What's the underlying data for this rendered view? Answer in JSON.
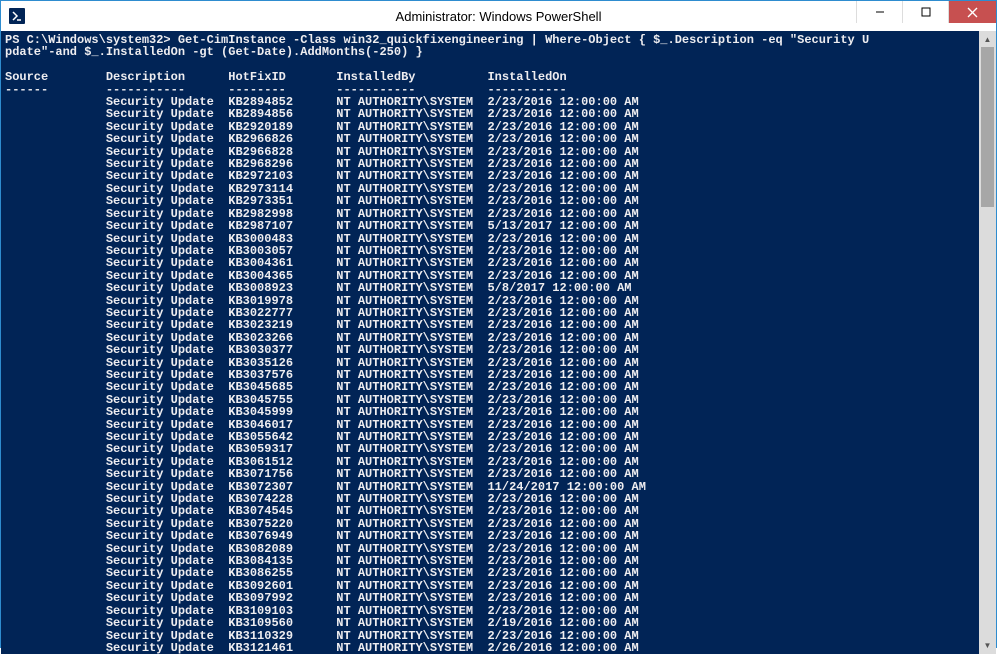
{
  "window": {
    "title": "Administrator: Windows PowerShell"
  },
  "console": {
    "prompt": "PS C:\\Windows\\system32>",
    "command_line1": "PS C:\\Windows\\system32> Get-CimInstance -Class win32_quickfixengineering | Where-Object { $_.Description -eq \"Security U",
    "command_line2": "pdate\"-and $_.InstalledOn -gt (Get-Date).AddMonths(-250) }",
    "headers": {
      "source": "Source",
      "description": "Description",
      "hotfixid": "HotFixID",
      "installedby": "InstalledBy",
      "installedon": "InstalledOn"
    },
    "rows": [
      {
        "source": "",
        "description": "Security Update",
        "hotfixid": "KB2894852",
        "installedby": "NT AUTHORITY\\SYSTEM",
        "installedon": "2/23/2016 12:00:00 AM"
      },
      {
        "source": "",
        "description": "Security Update",
        "hotfixid": "KB2894856",
        "installedby": "NT AUTHORITY\\SYSTEM",
        "installedon": "2/23/2016 12:00:00 AM"
      },
      {
        "source": "",
        "description": "Security Update",
        "hotfixid": "KB2920189",
        "installedby": "NT AUTHORITY\\SYSTEM",
        "installedon": "2/23/2016 12:00:00 AM"
      },
      {
        "source": "",
        "description": "Security Update",
        "hotfixid": "KB2966826",
        "installedby": "NT AUTHORITY\\SYSTEM",
        "installedon": "2/23/2016 12:00:00 AM"
      },
      {
        "source": "",
        "description": "Security Update",
        "hotfixid": "KB2966828",
        "installedby": "NT AUTHORITY\\SYSTEM",
        "installedon": "2/23/2016 12:00:00 AM"
      },
      {
        "source": "",
        "description": "Security Update",
        "hotfixid": "KB2968296",
        "installedby": "NT AUTHORITY\\SYSTEM",
        "installedon": "2/23/2016 12:00:00 AM"
      },
      {
        "source": "",
        "description": "Security Update",
        "hotfixid": "KB2972103",
        "installedby": "NT AUTHORITY\\SYSTEM",
        "installedon": "2/23/2016 12:00:00 AM"
      },
      {
        "source": "",
        "description": "Security Update",
        "hotfixid": "KB2973114",
        "installedby": "NT AUTHORITY\\SYSTEM",
        "installedon": "2/23/2016 12:00:00 AM"
      },
      {
        "source": "",
        "description": "Security Update",
        "hotfixid": "KB2973351",
        "installedby": "NT AUTHORITY\\SYSTEM",
        "installedon": "2/23/2016 12:00:00 AM"
      },
      {
        "source": "",
        "description": "Security Update",
        "hotfixid": "KB2982998",
        "installedby": "NT AUTHORITY\\SYSTEM",
        "installedon": "2/23/2016 12:00:00 AM"
      },
      {
        "source": "",
        "description": "Security Update",
        "hotfixid": "KB2987107",
        "installedby": "NT AUTHORITY\\SYSTEM",
        "installedon": "5/13/2017 12:00:00 AM"
      },
      {
        "source": "",
        "description": "Security Update",
        "hotfixid": "KB3000483",
        "installedby": "NT AUTHORITY\\SYSTEM",
        "installedon": "2/23/2016 12:00:00 AM"
      },
      {
        "source": "",
        "description": "Security Update",
        "hotfixid": "KB3003057",
        "installedby": "NT AUTHORITY\\SYSTEM",
        "installedon": "2/23/2016 12:00:00 AM"
      },
      {
        "source": "",
        "description": "Security Update",
        "hotfixid": "KB3004361",
        "installedby": "NT AUTHORITY\\SYSTEM",
        "installedon": "2/23/2016 12:00:00 AM"
      },
      {
        "source": "",
        "description": "Security Update",
        "hotfixid": "KB3004365",
        "installedby": "NT AUTHORITY\\SYSTEM",
        "installedon": "2/23/2016 12:00:00 AM"
      },
      {
        "source": "",
        "description": "Security Update",
        "hotfixid": "KB3008923",
        "installedby": "NT AUTHORITY\\SYSTEM",
        "installedon": "5/8/2017 12:00:00 AM"
      },
      {
        "source": "",
        "description": "Security Update",
        "hotfixid": "KB3019978",
        "installedby": "NT AUTHORITY\\SYSTEM",
        "installedon": "2/23/2016 12:00:00 AM"
      },
      {
        "source": "",
        "description": "Security Update",
        "hotfixid": "KB3022777",
        "installedby": "NT AUTHORITY\\SYSTEM",
        "installedon": "2/23/2016 12:00:00 AM"
      },
      {
        "source": "",
        "description": "Security Update",
        "hotfixid": "KB3023219",
        "installedby": "NT AUTHORITY\\SYSTEM",
        "installedon": "2/23/2016 12:00:00 AM"
      },
      {
        "source": "",
        "description": "Security Update",
        "hotfixid": "KB3023266",
        "installedby": "NT AUTHORITY\\SYSTEM",
        "installedon": "2/23/2016 12:00:00 AM"
      },
      {
        "source": "",
        "description": "Security Update",
        "hotfixid": "KB3030377",
        "installedby": "NT AUTHORITY\\SYSTEM",
        "installedon": "2/23/2016 12:00:00 AM"
      },
      {
        "source": "",
        "description": "Security Update",
        "hotfixid": "KB3035126",
        "installedby": "NT AUTHORITY\\SYSTEM",
        "installedon": "2/23/2016 12:00:00 AM"
      },
      {
        "source": "",
        "description": "Security Update",
        "hotfixid": "KB3037576",
        "installedby": "NT AUTHORITY\\SYSTEM",
        "installedon": "2/23/2016 12:00:00 AM"
      },
      {
        "source": "",
        "description": "Security Update",
        "hotfixid": "KB3045685",
        "installedby": "NT AUTHORITY\\SYSTEM",
        "installedon": "2/23/2016 12:00:00 AM"
      },
      {
        "source": "",
        "description": "Security Update",
        "hotfixid": "KB3045755",
        "installedby": "NT AUTHORITY\\SYSTEM",
        "installedon": "2/23/2016 12:00:00 AM"
      },
      {
        "source": "",
        "description": "Security Update",
        "hotfixid": "KB3045999",
        "installedby": "NT AUTHORITY\\SYSTEM",
        "installedon": "2/23/2016 12:00:00 AM"
      },
      {
        "source": "",
        "description": "Security Update",
        "hotfixid": "KB3046017",
        "installedby": "NT AUTHORITY\\SYSTEM",
        "installedon": "2/23/2016 12:00:00 AM"
      },
      {
        "source": "",
        "description": "Security Update",
        "hotfixid": "KB3055642",
        "installedby": "NT AUTHORITY\\SYSTEM",
        "installedon": "2/23/2016 12:00:00 AM"
      },
      {
        "source": "",
        "description": "Security Update",
        "hotfixid": "KB3059317",
        "installedby": "NT AUTHORITY\\SYSTEM",
        "installedon": "2/23/2016 12:00:00 AM"
      },
      {
        "source": "",
        "description": "Security Update",
        "hotfixid": "KB3061512",
        "installedby": "NT AUTHORITY\\SYSTEM",
        "installedon": "2/23/2016 12:00:00 AM"
      },
      {
        "source": "",
        "description": "Security Update",
        "hotfixid": "KB3071756",
        "installedby": "NT AUTHORITY\\SYSTEM",
        "installedon": "2/23/2016 12:00:00 AM"
      },
      {
        "source": "",
        "description": "Security Update",
        "hotfixid": "KB3072307",
        "installedby": "NT AUTHORITY\\SYSTEM",
        "installedon": "11/24/2017 12:00:00 AM"
      },
      {
        "source": "",
        "description": "Security Update",
        "hotfixid": "KB3074228",
        "installedby": "NT AUTHORITY\\SYSTEM",
        "installedon": "2/23/2016 12:00:00 AM"
      },
      {
        "source": "",
        "description": "Security Update",
        "hotfixid": "KB3074545",
        "installedby": "NT AUTHORITY\\SYSTEM",
        "installedon": "2/23/2016 12:00:00 AM"
      },
      {
        "source": "",
        "description": "Security Update",
        "hotfixid": "KB3075220",
        "installedby": "NT AUTHORITY\\SYSTEM",
        "installedon": "2/23/2016 12:00:00 AM"
      },
      {
        "source": "",
        "description": "Security Update",
        "hotfixid": "KB3076949",
        "installedby": "NT AUTHORITY\\SYSTEM",
        "installedon": "2/23/2016 12:00:00 AM"
      },
      {
        "source": "",
        "description": "Security Update",
        "hotfixid": "KB3082089",
        "installedby": "NT AUTHORITY\\SYSTEM",
        "installedon": "2/23/2016 12:00:00 AM"
      },
      {
        "source": "",
        "description": "Security Update",
        "hotfixid": "KB3084135",
        "installedby": "NT AUTHORITY\\SYSTEM",
        "installedon": "2/23/2016 12:00:00 AM"
      },
      {
        "source": "",
        "description": "Security Update",
        "hotfixid": "KB3086255",
        "installedby": "NT AUTHORITY\\SYSTEM",
        "installedon": "2/23/2016 12:00:00 AM"
      },
      {
        "source": "",
        "description": "Security Update",
        "hotfixid": "KB3092601",
        "installedby": "NT AUTHORITY\\SYSTEM",
        "installedon": "2/23/2016 12:00:00 AM"
      },
      {
        "source": "",
        "description": "Security Update",
        "hotfixid": "KB3097992",
        "installedby": "NT AUTHORITY\\SYSTEM",
        "installedon": "2/23/2016 12:00:00 AM"
      },
      {
        "source": "",
        "description": "Security Update",
        "hotfixid": "KB3109103",
        "installedby": "NT AUTHORITY\\SYSTEM",
        "installedon": "2/23/2016 12:00:00 AM"
      },
      {
        "source": "",
        "description": "Security Update",
        "hotfixid": "KB3109560",
        "installedby": "NT AUTHORITY\\SYSTEM",
        "installedon": "2/19/2016 12:00:00 AM"
      },
      {
        "source": "",
        "description": "Security Update",
        "hotfixid": "KB3110329",
        "installedby": "NT AUTHORITY\\SYSTEM",
        "installedon": "2/23/2016 12:00:00 AM"
      },
      {
        "source": "",
        "description": "Security Update",
        "hotfixid": "KB3121461",
        "installedby": "NT AUTHORITY\\SYSTEM",
        "installedon": "2/26/2016 12:00:00 AM"
      }
    ]
  }
}
